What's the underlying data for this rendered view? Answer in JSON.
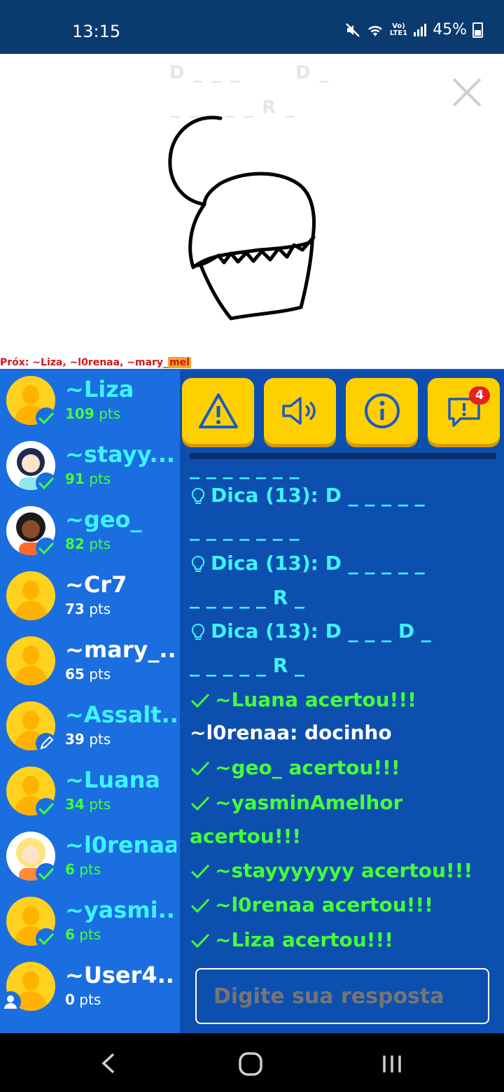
{
  "status": {
    "time": "13:15",
    "lte": "Vo)\nLTE1",
    "battery": "45%"
  },
  "canvas": {
    "hint_row1_a": "D _ _ _",
    "hint_row1_b": "D _",
    "hint_row2": "_ _ _ _ _ R _"
  },
  "next_bar": {
    "label": "Próx:",
    "names": "~Liza, ~l0renaa, ~mary_",
    "highlight": "mel"
  },
  "players": [
    {
      "name": "~Liza",
      "points": "109",
      "unit": "pts",
      "status": "guessed"
    },
    {
      "name": "~stayy...",
      "points": "91",
      "unit": "pts",
      "status": "guessed"
    },
    {
      "name": "~geo_",
      "points": "82",
      "unit": "pts",
      "status": "guessed"
    },
    {
      "name": "~Cr7",
      "points": "73",
      "unit": "pts",
      "status": "none"
    },
    {
      "name": "~mary_...",
      "points": "65",
      "unit": "pts",
      "status": "none"
    },
    {
      "name": "~Assalt...",
      "points": "39",
      "unit": "pts",
      "status": "drawing"
    },
    {
      "name": "~Luana",
      "points": "34",
      "unit": "pts",
      "status": "guessed"
    },
    {
      "name": "~l0renaa",
      "points": "6",
      "unit": "pts",
      "status": "guessed"
    },
    {
      "name": "~yasmi...",
      "points": "6",
      "unit": "pts",
      "status": "guessed"
    },
    {
      "name": "~User4...",
      "points": "0",
      "unit": "pts",
      "status": "me"
    }
  ],
  "toolbar": {
    "notifications": "4"
  },
  "chat": {
    "top_fragment": "_ _ _ _ _ _ _",
    "hint1_a": "Dica (13): D _ _ _  _ _",
    "hint1_b": "_ _ _ _ _ _ _",
    "hint2_a": "Dica (13): D _ _ _  _ _",
    "hint2_b": "_ _ _ _ _ R _",
    "hint3_a": "Dica (13): D _ _ _   D _",
    "hint3_b": "_ _ _ _ _ R _",
    "m1": "~Luana acertou!!!",
    "m2": "~l0renaa: docinho",
    "m3": "~geo_ acertou!!!",
    "m4a": "~yasminAmelhor",
    "m4b": "acertou!!!",
    "m5": "~stayyyyyyy acertou!!!",
    "m6": "~l0renaa acertou!!!",
    "m7": "~Liza acertou!!!"
  },
  "answer": {
    "placeholder": "Digite sua resposta"
  },
  "colors": {
    "accent": "#1a6ee0",
    "chat_bg": "#0d4fae",
    "button": "#ffd000",
    "guessed": "#44ff3a",
    "name": "#3ff2ff"
  }
}
